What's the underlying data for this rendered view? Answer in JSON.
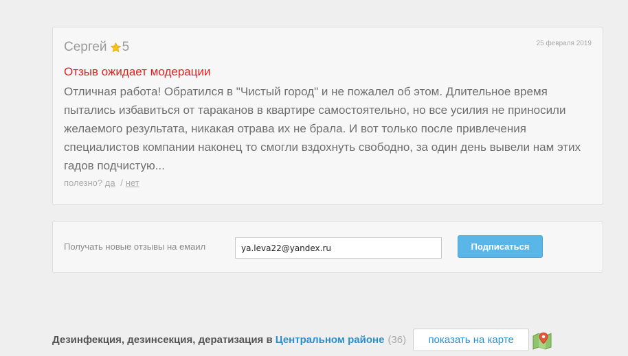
{
  "review": {
    "author": "Сергей",
    "rating": "5",
    "date": "25 февраля 2019",
    "moderation_notice": "Отзыв ожидает модерации",
    "text": "Отличная работа! Обратился в \"Чистый город\" и не пожалел об этом. Длительное время пытались избавиться от тараканов в квартире самостоятельно, но все усилия не приносили желаемого результата, никакая отрава их не брала. И вот только после привлечения специалистов компании наконец то смогли вздохнуть свободно, за один день вывели нам этих гадов подчистую...",
    "helpful_label": "полезно?",
    "helpful_yes": "да",
    "helpful_separator": "/",
    "helpful_no": "нет",
    "star_icon": "star-icon"
  },
  "subscribe": {
    "label": "Получать новые отзывы на емаил",
    "email_value": "ya.leva22@yandex.ru",
    "button_label": "Подписаться"
  },
  "footer": {
    "title": "Дезинфекция, дезинсекция, дератизация в",
    "district": "Центральном районе",
    "count": "(36)",
    "map_button": "показать на карте",
    "map_icon": "map-pin-icon"
  },
  "colors": {
    "accent": "#2a8fd0",
    "button": "#5ab6e7",
    "moderation": "#e21f1f",
    "background": "#efefef"
  }
}
